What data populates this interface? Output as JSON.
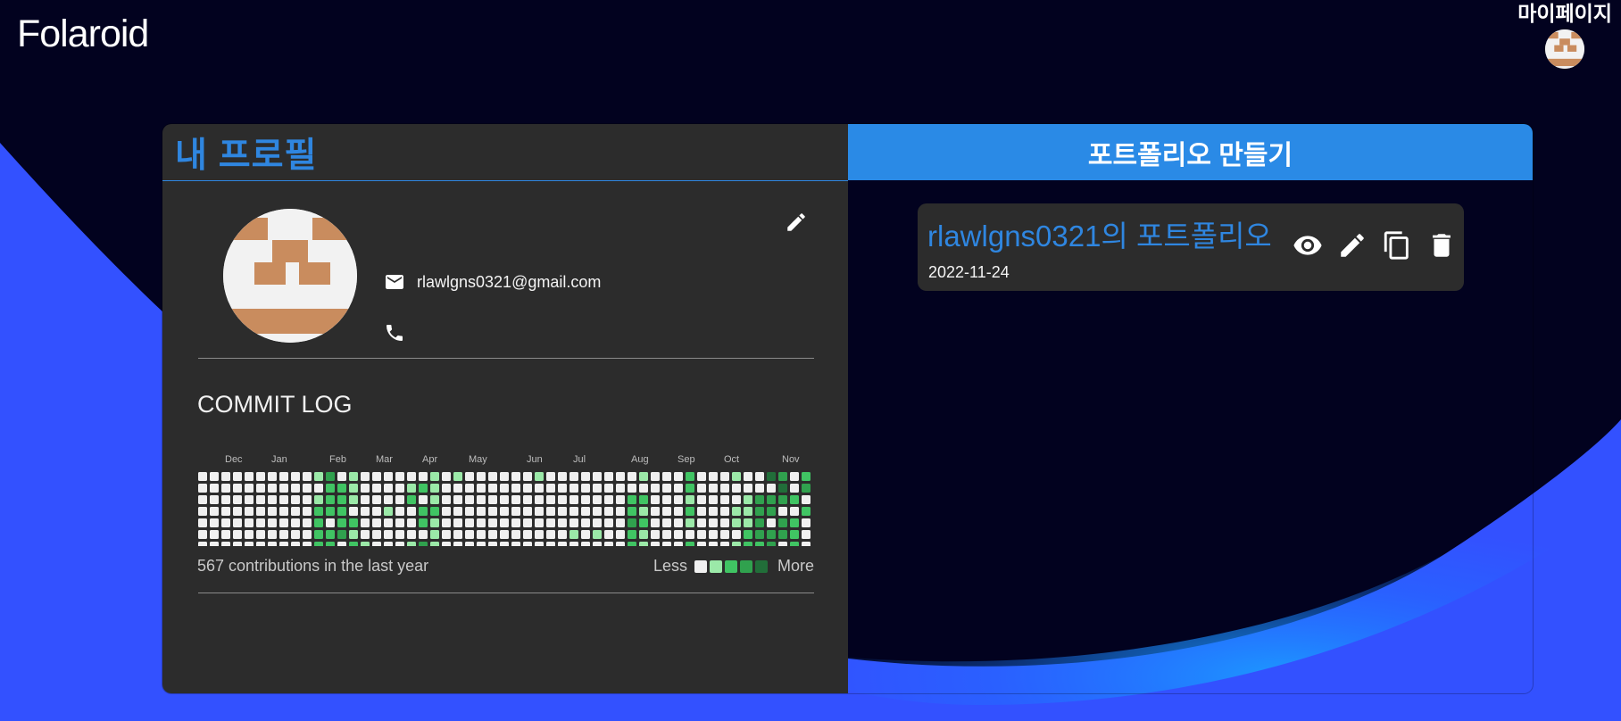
{
  "app": {
    "title": "Folaroid"
  },
  "header": {
    "mypage_label": "마이페이지",
    "avatar_icon": "pixel-avatar-icon"
  },
  "profile": {
    "title": "내 프로필",
    "email": "rlawlgns0321@gmail.com",
    "phone": "",
    "icons": {
      "edit": "pencil-icon",
      "email": "mail-icon",
      "phone": "phone-icon"
    }
  },
  "commit_log": {
    "title": "COMMIT LOG",
    "months": [
      "Dec",
      "Jan",
      "Feb",
      "Mar",
      "Apr",
      "May",
      "Jun",
      "Jul",
      "Aug",
      "Sep",
      "Oct",
      "Nov"
    ],
    "summary": "567 contributions in the last year",
    "legend_less": "Less",
    "legend_more": "More",
    "level_colors": [
      "#f0f0f0",
      "#9be9a8",
      "#40c463",
      "#30a14e",
      "#216e39"
    ]
  },
  "portfolio": {
    "create_label": "포트폴리오 만들기",
    "items": [
      {
        "title": "rlawlgns0321의 포트폴리오",
        "date": "2022-11-24"
      }
    ],
    "action_icons": [
      "eye-icon",
      "pencil-icon",
      "copy-icon",
      "trash-icon"
    ]
  },
  "colors": {
    "accent": "#2a8ae6",
    "panel": "#2c2c2c",
    "background": "#02021f",
    "wave": "#3355ff"
  }
}
